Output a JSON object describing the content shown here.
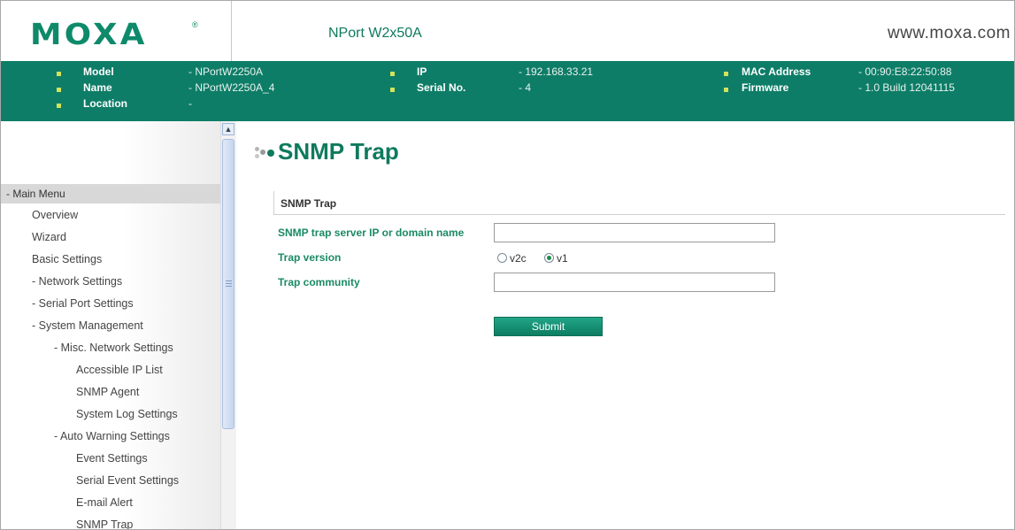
{
  "header": {
    "logo": "MOXA",
    "logo_mark": "®",
    "product": "NPort W2x50A",
    "website": "www.moxa.com"
  },
  "info": {
    "model_label": "Model",
    "model_value": "- NPortW2250A",
    "name_label": "Name",
    "name_value": "- NPortW2250A_4",
    "location_label": "Location",
    "location_value": "-",
    "ip_label": "IP",
    "ip_value": "- 192.168.33.21",
    "serial_label": "Serial No.",
    "serial_value": "- 4",
    "mac_label": "MAC Address",
    "mac_value": "- 00:90:E8:22:50:88",
    "firmware_label": "Firmware",
    "firmware_value": "- 1.0 Build 12041115"
  },
  "menu": {
    "head": "- Main Menu",
    "items": [
      "Overview",
      "Wizard",
      "Basic Settings",
      "- Network Settings",
      "- Serial Port Settings",
      "- System Management",
      "- Misc. Network Settings",
      "Accessible IP List",
      "SNMP Agent",
      "System Log Settings",
      "- Auto Warning Settings",
      "Event Settings",
      "Serial Event Settings",
      "E-mail Alert",
      "SNMP Trap"
    ]
  },
  "scrollbar": {
    "up_icon": "▲"
  },
  "main": {
    "page_title": "SNMP Trap",
    "section_title": "SNMP Trap",
    "server_label": "SNMP trap server IP or domain name",
    "server_value": "",
    "version_label": "Trap version",
    "version_options": [
      "v2c",
      "v1"
    ],
    "version_selected": "v1",
    "community_label": "Trap community",
    "community_value": "",
    "submit_label": "Submit"
  },
  "colors": {
    "brand_green": "#0e7d67",
    "label_green": "#1a8a64",
    "bullet": "#d3e25c"
  }
}
